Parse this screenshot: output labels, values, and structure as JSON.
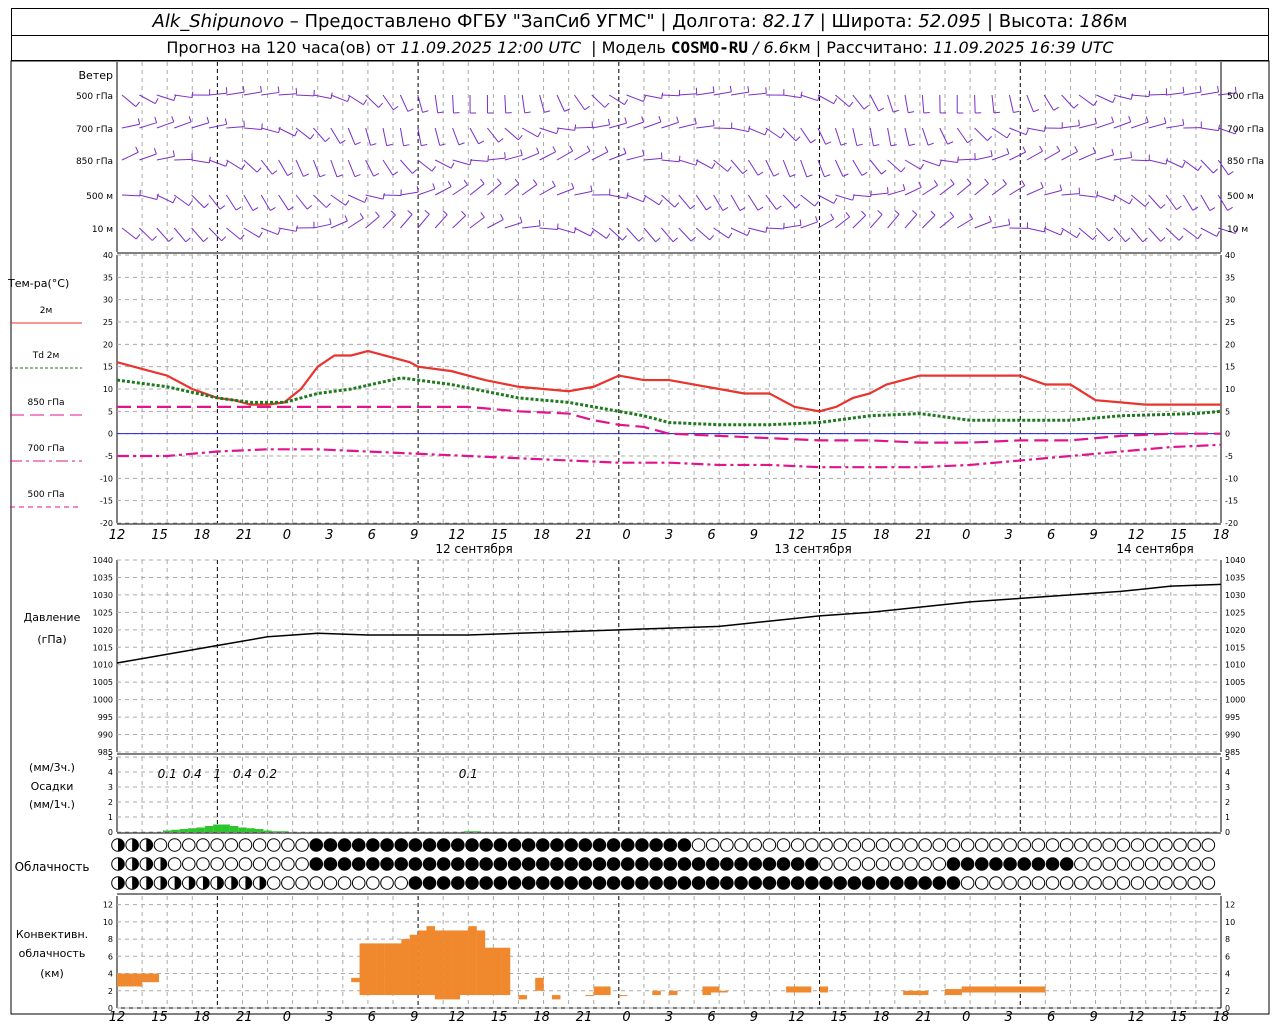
{
  "header": {
    "station": "Alk_Shipunovo",
    "provider": "– Предоставлено ФГБУ \"ЗапСиб УГМС\"",
    "lon_label": "Долгота:",
    "lon": "82.17",
    "lat_label": "Широта:",
    "lat": "52.095",
    "alt_label": "Высота:",
    "alt": "186",
    "alt_unit": "м",
    "forecast_label": "Прогноз на 120 часа(ов) от",
    "forecast_time": "11.09.2025 12:00 UTC",
    "model_label": "Модель",
    "model": "COSMO-RU",
    "model_res": "/ 6.6",
    "model_res_unit": "км",
    "calc_label": "Рассчитано:",
    "calc_time": "11.09.2025 16:39 UTC"
  },
  "wind_panel": {
    "title": "Ветер",
    "levels": [
      "500 гПа",
      "700 гПа",
      "850 гПа",
      "500 м",
      "10  м"
    ]
  },
  "temp_panel": {
    "title": "Тем-ра(°C)",
    "legend": [
      {
        "label": "2м",
        "color": "#e8342e",
        "dash": ""
      },
      {
        "label": "Td  2м",
        "color": "#1e7a1e",
        "dash": "3,2"
      },
      {
        "label": "850 гПа",
        "color": "#e0148c",
        "dash": "14,6"
      },
      {
        "label": "700 гПа",
        "color": "#e0148c",
        "dash": "12,4,3,4"
      },
      {
        "label": "500 гПа",
        "color": "#e0148c",
        "dash": "5,4"
      }
    ],
    "y_ticks": [
      "40",
      "35",
      "30",
      "25",
      "20",
      "15",
      "10",
      "5",
      "0",
      "-5",
      "-10",
      "-15",
      "-20"
    ]
  },
  "time_axis": {
    "hour_labels": [
      "12",
      "15",
      "18",
      "21",
      "0",
      "3",
      "6",
      "9",
      "12",
      "15",
      "18",
      "21",
      "0",
      "3",
      "6",
      "9",
      "12",
      "15",
      "18",
      "21",
      "0",
      "3",
      "6",
      "9",
      "12",
      "15",
      "18"
    ],
    "dates": [
      "12 сентября",
      "13 сентября",
      "14 сентября"
    ]
  },
  "pressure_panel": {
    "title": "Давление",
    "unit": "(гПа)",
    "y_ticks": [
      "1040",
      "1035",
      "1030",
      "1025",
      "1020",
      "1015",
      "1010",
      "1005",
      "1000",
      "995",
      "990",
      "985"
    ]
  },
  "precip_panel": {
    "unit3": "(мм/3ч.)",
    "title": "Осадки",
    "unit1": "(мм/1ч.)",
    "y_ticks": [
      "5",
      "4",
      "3",
      "2",
      "1",
      "0"
    ],
    "labels": [
      {
        "text": "0.1",
        "hour": 6
      },
      {
        "text": "0.4",
        "hour": 9
      },
      {
        "text": "1",
        "hour": 12
      },
      {
        "text": "0.4",
        "hour": 15
      },
      {
        "text": "0.2",
        "hour": 18
      },
      {
        "text": "0.1",
        "hour": 42
      }
    ]
  },
  "cloud_panel": {
    "title": "Облачность"
  },
  "conv_panel": {
    "title1": "Конвективн.",
    "title2": "облачность",
    "unit": "(км)",
    "y_ticks": [
      "12",
      "10",
      "8",
      "6",
      "4",
      "2",
      "0"
    ]
  },
  "chart_data": [
    {
      "type": "line",
      "title": "Тем-ра(°C)",
      "x_unit": "hours from 11.09.2025 12:00 UTC",
      "ylim": [
        -20,
        40
      ],
      "series": [
        {
          "name": "2м",
          "x": [
            0,
            3,
            6,
            9,
            12,
            14,
            16,
            18,
            20,
            22,
            24,
            26,
            28,
            30,
            32,
            33,
            35,
            36,
            40,
            44,
            48,
            51,
            54,
            57,
            60,
            63,
            66,
            69,
            72,
            75,
            78,
            81,
            84,
            86,
            88,
            90,
            92,
            94,
            96,
            100,
            102,
            105,
            108,
            111,
            114,
            117,
            120,
            123,
            126,
            129,
            132
          ],
          "y": [
            16,
            14.5,
            13,
            10,
            8,
            7.5,
            6.5,
            6.5,
            7,
            10,
            15,
            17.5,
            17.5,
            18.5,
            17.5,
            17,
            16,
            15,
            14,
            12,
            10.5,
            10,
            9.5,
            10.5,
            13,
            12,
            12,
            11,
            10,
            9,
            9,
            6,
            5,
            6,
            8,
            9,
            11,
            12,
            13,
            13,
            13,
            13,
            13,
            11,
            11,
            7.5,
            7,
            6.5,
            6.5,
            6.5,
            6.5
          ]
        },
        {
          "name": "Td  2м",
          "x": [
            0,
            6,
            12,
            16,
            18,
            20,
            24,
            28,
            34,
            40,
            44,
            48,
            54,
            60,
            63,
            66,
            72,
            78,
            84,
            90,
            96,
            102,
            108,
            114,
            120,
            129,
            132
          ],
          "y": [
            12,
            10.5,
            8,
            7,
            7,
            7,
            9,
            10,
            12.5,
            11,
            9.5,
            8,
            7,
            5,
            4,
            2.5,
            2,
            2,
            2.5,
            4,
            4.5,
            3,
            3,
            3,
            4,
            4.5,
            5
          ]
        },
        {
          "name": "850 гПа",
          "x": [
            0,
            6,
            12,
            18,
            24,
            30,
            36,
            42,
            48,
            54,
            57,
            60,
            63,
            66,
            72,
            78,
            84,
            90,
            96,
            102,
            108,
            114,
            120,
            126,
            132
          ],
          "y": [
            6,
            6,
            6,
            6,
            6,
            6,
            6,
            6,
            5,
            4.5,
            3,
            2,
            1.5,
            0,
            -0.5,
            -1,
            -1.5,
            -1.5,
            -2,
            -2,
            -1.5,
            -1.5,
            -0.5,
            0,
            0
          ]
        },
        {
          "name": "700 гПа",
          "x": [
            0,
            6,
            12,
            18,
            24,
            30,
            36,
            42,
            48,
            54,
            60,
            66,
            72,
            78,
            84,
            90,
            96,
            102,
            108,
            114,
            120,
            126,
            132
          ],
          "y": [
            -5,
            -5,
            -4,
            -3.5,
            -3.5,
            -4,
            -4.5,
            -5,
            -5.5,
            -6,
            -6.5,
            -6.5,
            -7,
            -7,
            -7.5,
            -7.5,
            -7.5,
            -7,
            -6,
            -5,
            -4,
            -3,
            -2.5
          ]
        }
      ]
    },
    {
      "type": "line",
      "title": "Давление",
      "ylim": [
        985,
        1040
      ],
      "series": [
        {
          "name": "Давление",
          "x": [
            0,
            6,
            12,
            18,
            24,
            30,
            36,
            42,
            48,
            54,
            60,
            66,
            72,
            78,
            84,
            90,
            96,
            102,
            108,
            114,
            120,
            126,
            132
          ],
          "y": [
            1010.5,
            1013,
            1015.5,
            1018,
            1019,
            1018.5,
            1018.5,
            1018.5,
            1019,
            1019.5,
            1020,
            1020.5,
            1021,
            1022.5,
            1024,
            1025,
            1026.5,
            1028,
            1029,
            1030,
            1031,
            1032.5,
            1033
          ]
        }
      ]
    },
    {
      "type": "bar",
      "title": "Осадки",
      "ylim": [
        0,
        5
      ],
      "series": [
        {
          "name": "мм/1ч.",
          "x": [
            6,
            7,
            8,
            9,
            10,
            11,
            12,
            13,
            14,
            15,
            16,
            17,
            18,
            19,
            20,
            42,
            43
          ],
          "y": [
            0.1,
            0.15,
            0.2,
            0.25,
            0.3,
            0.4,
            0.5,
            0.5,
            0.4,
            0.3,
            0.25,
            0.2,
            0.1,
            0.05,
            0.05,
            0.05,
            0.05
          ]
        }
      ]
    },
    {
      "type": "bar",
      "title": "Конвективн. облачность",
      "ylim": [
        0,
        13
      ],
      "series": [
        {
          "name": "top",
          "x": [
            0,
            1,
            2,
            3,
            4,
            28,
            29,
            30,
            31,
            32,
            33,
            34,
            35,
            36,
            37,
            38,
            39,
            40,
            41,
            42,
            43,
            44,
            45,
            46,
            48,
            50,
            52,
            56,
            57,
            58,
            60,
            64,
            66,
            70,
            71,
            72,
            80,
            81,
            82,
            84,
            94,
            95,
            96,
            99,
            100,
            101,
            102,
            103,
            104,
            105,
            106,
            107,
            108,
            109,
            110
          ],
          "y": [
            4,
            4,
            4,
            4,
            4,
            3.5,
            7.5,
            7.5,
            7.5,
            7.5,
            7.5,
            8,
            8.5,
            9,
            9.5,
            9,
            9,
            9,
            9,
            9.5,
            9,
            7,
            7,
            7,
            1.5,
            3.5,
            1.5,
            1.5,
            2.5,
            2.5,
            1.5,
            2,
            2,
            2.5,
            2.5,
            2,
            2.5,
            2.5,
            2.5,
            2.5,
            2,
            2,
            2,
            2.2,
            2.2,
            2.5,
            2.5,
            2.5,
            2.5,
            2.5,
            2.5,
            2.5,
            2.5,
            2.5,
            2.5
          ]
        },
        {
          "name": "base",
          "x": [
            0,
            1,
            2,
            3,
            4,
            28,
            29,
            30,
            31,
            32,
            33,
            34,
            35,
            36,
            37,
            38,
            39,
            40,
            41,
            42,
            43,
            44,
            45,
            46,
            48,
            50,
            52,
            56,
            57,
            58,
            60,
            64,
            66,
            70,
            71,
            72,
            80,
            81,
            82,
            84,
            94,
            95,
            96,
            99,
            100,
            101,
            102,
            103,
            104,
            105,
            106,
            107,
            108,
            109,
            110
          ],
          "y": [
            2.5,
            2.5,
            2.5,
            3,
            3,
            3,
            1.5,
            1.5,
            1.5,
            1.5,
            1.5,
            1.5,
            1.5,
            1.5,
            1.5,
            1,
            1,
            1,
            1.5,
            1.5,
            1.5,
            1.5,
            1.5,
            1.5,
            1,
            2,
            1,
            1.5,
            1.5,
            1.5,
            1.5,
            1.5,
            1.5,
            1.5,
            1.8,
            1.8,
            1.8,
            1.8,
            1.8,
            1.8,
            1.5,
            1.5,
            1.5,
            1.5,
            1.5,
            1.8,
            1.8,
            1.8,
            1.8,
            1.8,
            1.8,
            1.8,
            1.8,
            1.8,
            1.8
          ]
        }
      ]
    }
  ]
}
